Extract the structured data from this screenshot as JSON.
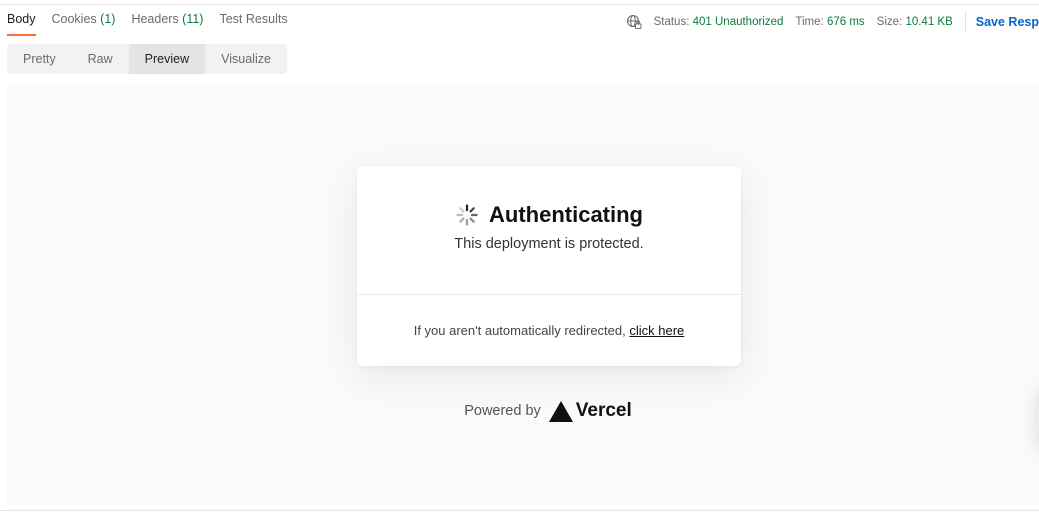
{
  "response_tabs": [
    {
      "label": "Body",
      "count": ""
    },
    {
      "label": "Cookies",
      "count": "(1)"
    },
    {
      "label": "Headers",
      "count": "(11)"
    },
    {
      "label": "Test Results",
      "count": ""
    }
  ],
  "status_bar": {
    "status_label": "Status:",
    "status_value": "401 Unauthorized",
    "time_label": "Time:",
    "time_value": "676 ms",
    "size_label": "Size:",
    "size_value": "10.41 KB",
    "save_label": "Save Resp"
  },
  "view_modes": [
    "Pretty",
    "Raw",
    "Preview",
    "Visualize"
  ],
  "preview": {
    "title": "Authenticating",
    "subtitle": "This deployment is protected.",
    "redirect_text": "If you aren't automatically redirected, ",
    "redirect_link": "click here",
    "powered_by": "Powered by",
    "brand": "Vercel"
  },
  "colors": {
    "accent": "#ff6c37",
    "success": "#0c7b3e",
    "link": "#0265d2"
  },
  "icons": {
    "network": "globe-lock-icon",
    "spinner": "spinner-icon",
    "brand": "vercel-triangle-icon"
  }
}
